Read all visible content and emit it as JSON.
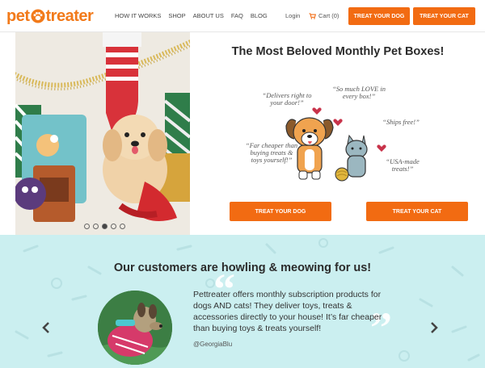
{
  "header": {
    "logo_left": "pet",
    "logo_right": "treater",
    "nav": [
      "HOW IT WORKS",
      "SHOP",
      "ABOUT US",
      "FAQ",
      "BLOG"
    ],
    "login": "Login",
    "cart": "Cart (0)",
    "treat_dog": "TREAT YOUR DOG",
    "treat_cat": "TREAT YOUR CAT"
  },
  "hero": {
    "title": "The Most Beloved Monthly Pet Boxes!",
    "quotes": {
      "delivers": "“Delivers right to your door!”",
      "love": "“So much LOVE in every box!”",
      "ships": "“Ships free!”",
      "cheaper": "“Far cheaper than buying treats & toys yourself!”",
      "usa": "“USA-made treats!”"
    },
    "cta_dog": "TREAT YOUR DOG",
    "cta_cat": "TREAT YOUR CAT",
    "carousel_active_index": 3,
    "carousel_count": 5
  },
  "testimonial": {
    "title": "Our customers are howling & meowing for us!",
    "text": "Pettreater offers monthly subscription products for dogs AND cats! They deliver toys, treats & accessories directly to your house! It’s far cheaper than buying toys & treats yourself!",
    "handle": "@GeorgiaBlu"
  },
  "colors": {
    "brand_orange": "#f26b12",
    "testimonial_bg": "#cbeff0"
  }
}
